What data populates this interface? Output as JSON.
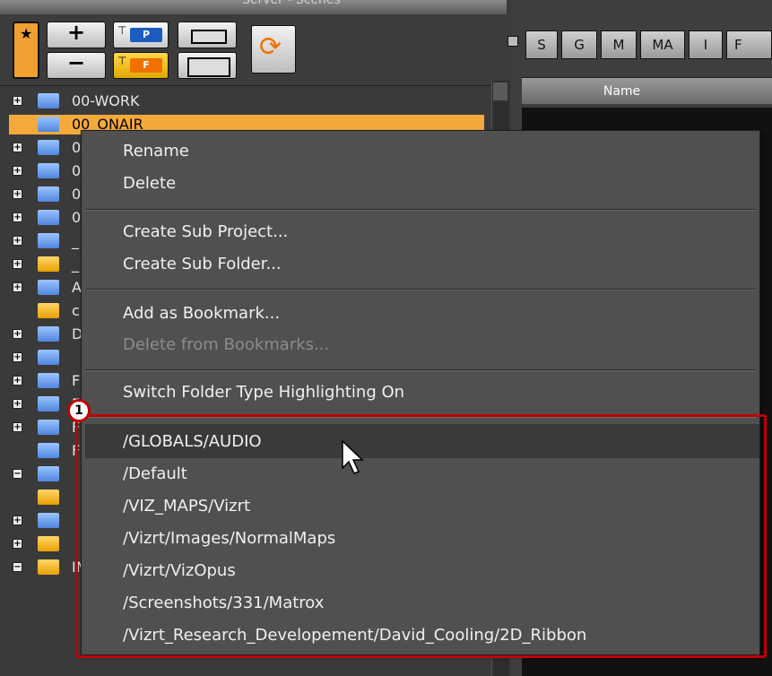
{
  "window": {
    "title": "Server - Scenes"
  },
  "toolbar": {
    "bookmark_glyph": "★",
    "add_glyph": "+",
    "remove_glyph": "−",
    "new_project_label": "P",
    "new_folder_label": "F",
    "sync_glyph": "⟳"
  },
  "tree": {
    "rows": [
      {
        "label": "00-WORK",
        "expander": "+",
        "folder": "blue",
        "selected": false
      },
      {
        "label": "00_ONAIR",
        "expander": "",
        "folder": "blue",
        "selected": true
      },
      {
        "label": "0",
        "expander": "+",
        "folder": "blue",
        "selected": false
      },
      {
        "label": "0",
        "expander": "+",
        "folder": "blue",
        "selected": false
      },
      {
        "label": "0",
        "expander": "+",
        "folder": "blue",
        "selected": false
      },
      {
        "label": "0",
        "expander": "+",
        "folder": "blue",
        "selected": false
      },
      {
        "label": "_",
        "expander": "+",
        "folder": "blue",
        "selected": false
      },
      {
        "label": "_",
        "expander": "+",
        "folder": "yellow",
        "selected": false
      },
      {
        "label": "A",
        "expander": "+",
        "folder": "blue",
        "selected": false
      },
      {
        "label": "c",
        "expander": "",
        "folder": "yellow",
        "selected": false
      },
      {
        "label": "D",
        "expander": "+",
        "folder": "blue",
        "selected": false
      },
      {
        "label": "",
        "expander": "+",
        "folder": "blue",
        "selected": false
      },
      {
        "label": "F",
        "expander": "+",
        "folder": "blue",
        "selected": false
      },
      {
        "label": "F",
        "expander": "+",
        "folder": "blue",
        "selected": false
      },
      {
        "label": "F",
        "expander": "+",
        "folder": "blue",
        "selected": false
      },
      {
        "label": "F",
        "expander": "",
        "folder": "blue",
        "selected": false
      },
      {
        "label": "",
        "expander": "−",
        "folder": "blue",
        "selected": false
      },
      {
        "label": "",
        "expander": "",
        "folder": "yellow",
        "selected": false
      },
      {
        "label": "",
        "expander": "+",
        "folder": "blue",
        "selected": false
      },
      {
        "label": "",
        "expander": "+",
        "folder": "yellow",
        "selected": false
      },
      {
        "label": "IMAGE",
        "expander": "−",
        "folder": "yellow",
        "selected": false
      }
    ]
  },
  "right_panel": {
    "tabs": [
      "S",
      "G",
      "M",
      "MA",
      "I",
      "F"
    ],
    "column_header": "Name"
  },
  "context_menu": {
    "items": [
      {
        "label": "Rename",
        "enabled": true
      },
      {
        "label": "Delete",
        "enabled": true
      },
      {
        "label": "Create Sub Project...",
        "enabled": true
      },
      {
        "label": "Create Sub Folder...",
        "enabled": true
      },
      {
        "label": "Add as Bookmark...",
        "enabled": true
      },
      {
        "label": "Delete from Bookmarks...",
        "enabled": false
      },
      {
        "label": "Switch Folder Type Highlighting On",
        "enabled": true
      }
    ],
    "bookmarks": [
      "/GLOBALS/AUDIO",
      "/Default",
      "/VIZ_MAPS/Vizrt",
      "/Vizrt/Images/NormalMaps",
      "/Vizrt/VizOpus",
      "/Screenshots/331/Matrox",
      "/Vizrt_Research_Developement/David_Cooling/2D_Ribbon"
    ],
    "hovered_bookmark_index": 0
  },
  "callout": {
    "number": "1",
    "color": "#c00000"
  }
}
